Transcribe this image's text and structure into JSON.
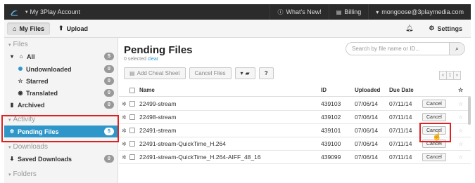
{
  "topbar": {
    "account_label": "My 3Play Account",
    "whats_new": "What's New!",
    "billing": "Billing",
    "user": "mongoose@3playmedia.com"
  },
  "subbar": {
    "my_files": "My Files",
    "upload": "Upload",
    "settings": "Settings"
  },
  "sidebar": {
    "files_header": "Files",
    "all": {
      "label": "All",
      "count": "5"
    },
    "undownloaded": {
      "label": "Undownloaded",
      "count": "0"
    },
    "starred": {
      "label": "Starred",
      "count": "0"
    },
    "translated": {
      "label": "Translated",
      "count": "0"
    },
    "archived": {
      "label": "Archived",
      "count": "0"
    },
    "activity_header": "Activity",
    "pending": {
      "label": "Pending Files",
      "count": "5"
    },
    "downloads_header": "Downloads",
    "saved_downloads": {
      "label": "Saved Downloads",
      "count": "0"
    },
    "folders_header": "Folders"
  },
  "main": {
    "title": "Pending Files",
    "selected_text": "0 selected",
    "clear": "clear",
    "search_placeholder": "Search by file name or ID...",
    "add_cheat_sheet": "Add Cheat Sheet",
    "cancel_files": "Cancel Files",
    "help": "?",
    "pager_prev": "«",
    "pager_page": "1",
    "pager_next": "»",
    "columns": {
      "name": "Name",
      "id": "ID",
      "uploaded": "Uploaded",
      "due": "Due Date"
    },
    "cancel_label": "Cancel",
    "rows": [
      {
        "name": "22499-stream",
        "id": "439103",
        "uploaded": "07/06/14",
        "due": "07/11/14"
      },
      {
        "name": "22498-stream",
        "id": "439102",
        "uploaded": "07/06/14",
        "due": "07/11/14"
      },
      {
        "name": "22491-stream",
        "id": "439101",
        "uploaded": "07/06/14",
        "due": "07/11/14"
      },
      {
        "name": "22491-stream-QuickTime_H.264",
        "id": "439100",
        "uploaded": "07/06/14",
        "due": "07/11/14"
      },
      {
        "name": "22491-stream-QuickTime_H.264-AIFF_48_16",
        "id": "439099",
        "uploaded": "07/06/14",
        "due": "07/11/14"
      }
    ]
  },
  "colors": {
    "accent": "#2f96c9",
    "navbar": "#2b2b2b",
    "highlight": "#dd2222"
  }
}
